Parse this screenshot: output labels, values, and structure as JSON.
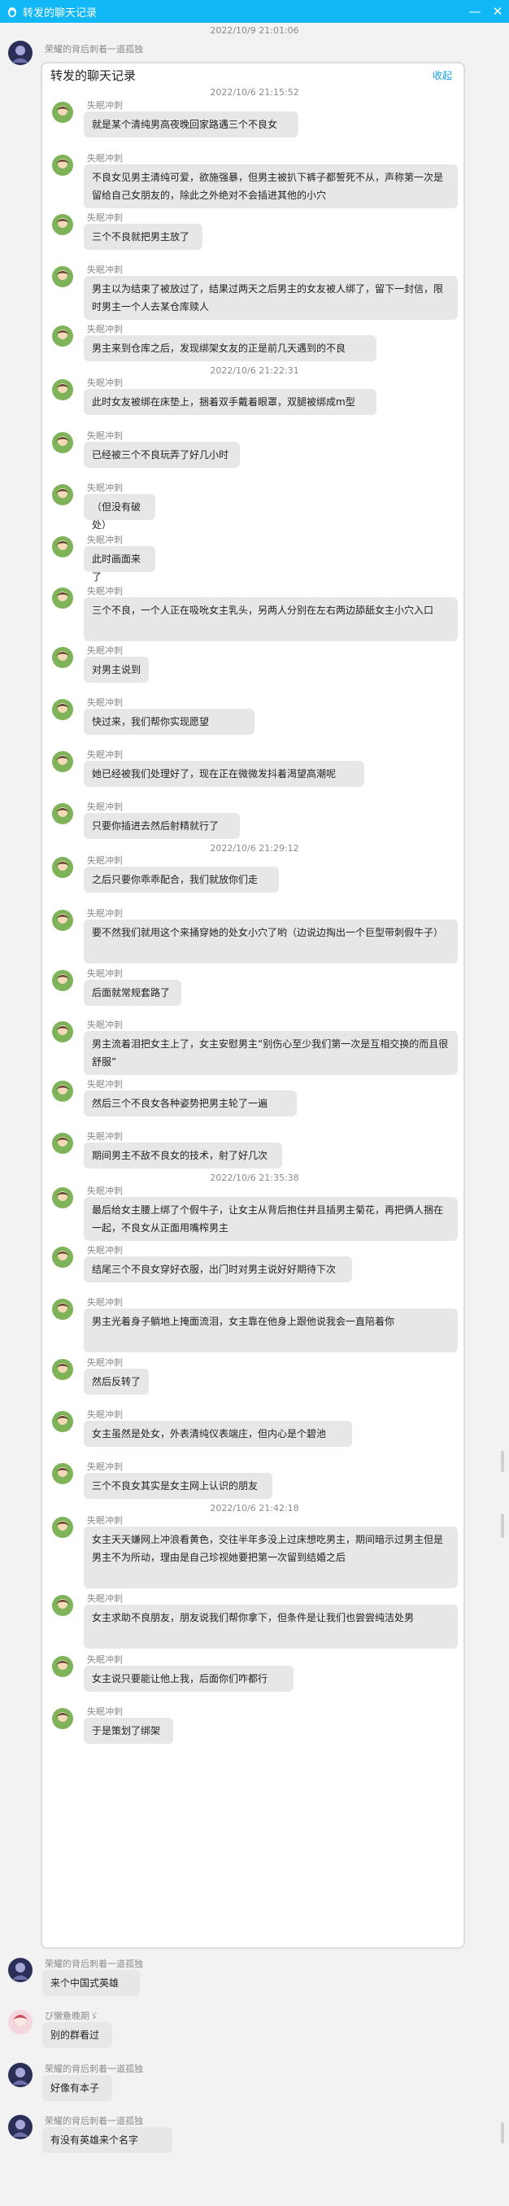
{
  "window": {
    "title": "转发的聊天记录",
    "minimize_label": "—",
    "close_label": "✕"
  },
  "outer_timestamp": "2022/10/9 21:01:06",
  "forwarder_name": "荣耀的背后刺着一道孤独",
  "card": {
    "title": "转发的聊天记录",
    "collapse_label": "收起",
    "sender_name": "失眠冲刺",
    "timestamps": [
      "2022/10/6 21:15:52",
      "2022/10/6 21:22:31",
      "2022/10/6 21:29:12",
      "2022/10/6 21:35:38",
      "2022/10/6 21:42:18"
    ],
    "messages": [
      "就是某个清纯男高夜晚回家路遇三个不良女",
      "不良女见男主清纯可爱，欲施强暴，但男主被扒下裤子都誓死不从，声称第一次是留给自己女朋友的，除此之外绝对不会插进其他的小穴",
      "三个不良就把男主放了",
      "男主以为结束了被放过了，结果过两天之后男主的女友被人绑了，留下一封信，限时男主一个人去某仓库赎人",
      "男主来到仓库之后，发现绑架女友的正是前几天遇到的不良",
      "此时女友被绑在床垫上，捆着双手戴着眼罩，双腿被绑成m型",
      "已经被三个不良玩弄了好几小时",
      "（但没有破处）",
      "此时画面来了",
      "三个不良，一个人正在吸吮女主乳头，另两人分别在左右两边舔舐女主小穴入口",
      "对男主说到",
      "快过来，我们帮你实现愿望",
      "她已经被我们处理好了，现在正在微微发抖着渴望高潮呢",
      "只要你插进去然后射精就行了",
      "之后只要你乖乖配合，我们就放你们走",
      "要不然我们就用这个来捅穿她的处女小穴了哟（边说边掏出一个巨型带刺假牛子）",
      "后面就常规套路了",
      "男主流着泪把女主上了，女主安慰男主“别伤心至少我们第一次是互相交换的而且很舒服”",
      "然后三个不良女各种姿势把男主轮了一遍",
      "期间男主不敌不良女的技术，射了好几次",
      "最后给女主腰上绑了个假牛子，让女主从背后抱住并且插男主菊花，再把俩人捆在一起，不良女从正面用嘴榨男主",
      "结尾三个不良女穿好衣服，出门时对男主说好好期待下次",
      "男主光着身子躺地上掩面流泪，女主靠在他身上跟他说我会一直陪着你",
      "然后反转了",
      "女主虽然是处女，外表清纯仪表端庄，但内心是个碧池",
      "三个不良女其实是女主网上认识的朋友",
      "女主天天嫌网上冲浪看黄色，交往半年多没上过床想吃男主，期间暗示过男主但是男主不为所动，理由是自己珍视她要把第一次留到结婚之后",
      "女主求助不良朋友，朋友说我们帮你拿下，但条件是让我们也尝尝纯洁处男",
      "女主说只要能让他上我，后面你们咋都行",
      "于是策划了绑架"
    ]
  },
  "bottom_chat": [
    {
      "name": "荣耀的背后刺着一道孤独",
      "text": "来个中国式英雄"
    },
    {
      "name": "び懒惫晚期ゞ",
      "text": "别的群看过"
    },
    {
      "name": "荣耀的背后刺着一道孤独",
      "text": "好像有本子"
    },
    {
      "name": "荣耀的背后刺着一道孤独",
      "text": "有没有英雄来个名字"
    }
  ]
}
